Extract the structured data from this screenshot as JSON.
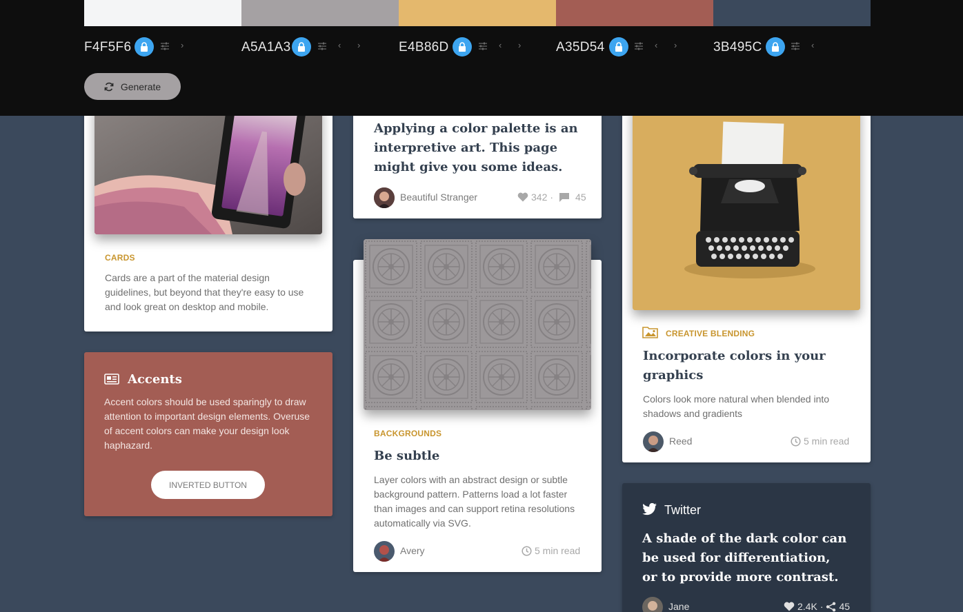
{
  "palette": {
    "swatches": [
      {
        "hex": "F4F5F6",
        "color": "#F4F5F6"
      },
      {
        "hex": "A5A1A3",
        "color": "#A5A1A3"
      },
      {
        "hex": "E4B86D",
        "color": "#E4B86D"
      },
      {
        "hex": "A35D54",
        "color": "#A35D54"
      },
      {
        "hex": "3B495C",
        "color": "#3B495C"
      }
    ],
    "generate_label": "Generate"
  },
  "cards_card": {
    "eyebrow": "CARDS",
    "text": "Cards are a part of the material design guidelines, but beyond that they're easy to use and look great on desktop and mobile."
  },
  "accents_card": {
    "title": "Accents",
    "text": "Accent colors should be used sparingly to draw attention to important design elements. Overuse of accent colors can make your design look haphazard.",
    "button_label": "INVERTED BUTTON",
    "background": "#A35D54"
  },
  "palette_article": {
    "title": "Applying a color palette is an interpretive art. This page might give you some ideas.",
    "author": "Beautiful Stranger",
    "likes": "342",
    "comments": "45"
  },
  "backgrounds_card": {
    "eyebrow": "BACKGROUNDS",
    "title": "Be subtle",
    "text": "Layer colors with an abstract design or subtle background pattern. Patterns load a lot faster than images and can support retina resolutions automatically via SVG.",
    "author": "Avery",
    "read_time": "5 min read"
  },
  "blending_card": {
    "eyebrow": "CREATIVE BLENDING",
    "title": "Incorporate colors in your graphics",
    "text": "Colors look more natural when blended into shadows and gradients",
    "author": "Reed",
    "read_time": "5 min read"
  },
  "twitter_card": {
    "label": "Twitter",
    "quote": "A shade of the dark color can be used for differentiation, or to provide more contrast.",
    "author": "Jane",
    "likes": "2.4K",
    "shares": "45"
  }
}
